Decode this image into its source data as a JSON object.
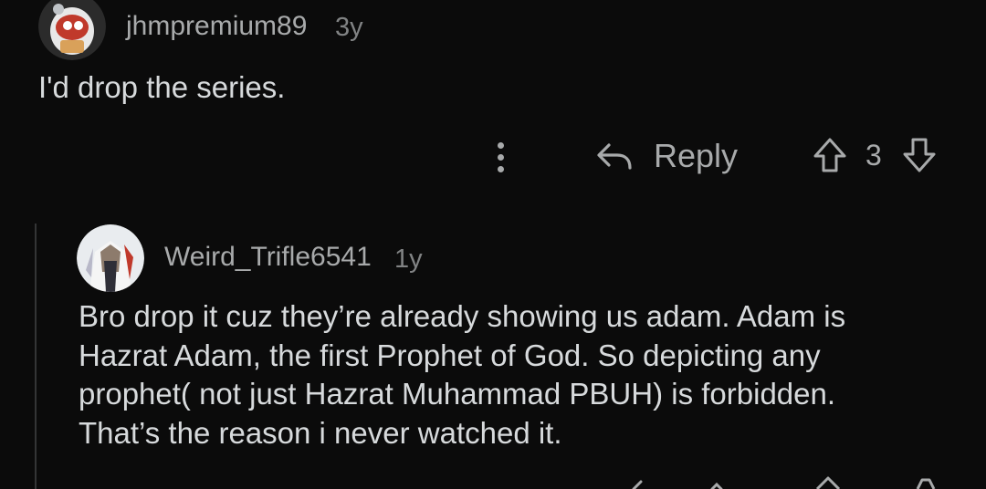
{
  "comment1": {
    "username": "jhmpremium89",
    "age": "3y",
    "body": "I'd drop the series.",
    "actions": {
      "more_icon": "more-vertical-icon",
      "reply_icon": "reply-arrow-icon",
      "reply_label": "Reply",
      "upvote_icon": "arrow-up-outline-icon",
      "score": "3",
      "downvote_icon": "arrow-down-outline-icon"
    }
  },
  "comment2": {
    "username": "Weird_Trifle6541",
    "age": "1y",
    "body_lines": [
      "Bro drop it cuz they’re already showing us adam. Adam is",
      "Hazrat Adam, the first Prophet of God. So depicting any",
      "prophet( not just Hazrat Muhammad PBUH) is forbidden.",
      "That’s the reason i never watched it."
    ]
  },
  "colors": {
    "background": "#0b0b0b",
    "text": "#d7dadc",
    "muted": "#a8aaab",
    "thread_line": "#343536"
  }
}
